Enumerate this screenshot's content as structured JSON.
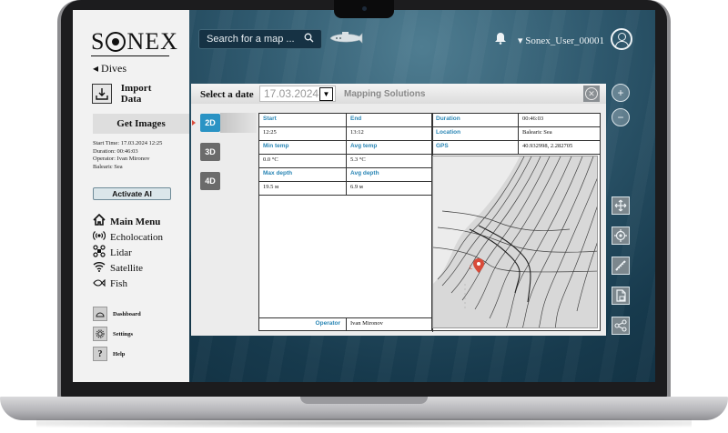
{
  "app": {
    "logo_text": "SONEX",
    "logo_left": "S",
    "logo_right": "NEX"
  },
  "sidebar": {
    "back_label": "◂ Dives",
    "import_label": "Import Data",
    "get_images_label": "Get Images",
    "dive_info": {
      "start_time": "Start Time: 17.03.2024 12:25",
      "duration": "Duration: 00:46:03",
      "operator": "Operator: Ivan Mironov",
      "location": "Balearic Sea"
    },
    "activate_ai_label": "Activate AI",
    "nav_items": [
      {
        "label": "Main Menu",
        "icon": "home-icon",
        "bold": true
      },
      {
        "label": "Echolocation",
        "icon": "echolocation-icon",
        "bold": false
      },
      {
        "label": "Lidar",
        "icon": "drone-icon",
        "bold": false
      },
      {
        "label": "Satellite",
        "icon": "satellite-icon",
        "bold": false
      },
      {
        "label": "Fish",
        "icon": "fish-icon",
        "bold": false
      }
    ],
    "small_items": [
      {
        "label": "Dashboard",
        "icon": "dashboard-icon"
      },
      {
        "label": "Settings",
        "icon": "settings-icon"
      },
      {
        "label": "Help",
        "icon": "help-icon"
      }
    ]
  },
  "header": {
    "search_placeholder": "Search for a map ...",
    "username": "▾ Sonex_User_00001"
  },
  "panel": {
    "select_date_label": "Select a date",
    "date_value": "17.03.2024",
    "title": "Mapping Solutions",
    "modes": [
      "2D",
      "3D",
      "4D"
    ],
    "active_mode": "2D",
    "fields": {
      "start_label": "Start",
      "start_value": "12:25",
      "end_label": "End",
      "end_value": "13:12",
      "min_temp_label": "Min temp",
      "min_temp_value": "0.0 °C",
      "avg_temp_label": "Avg temp",
      "avg_temp_value": "5.3 °C",
      "max_depth_label": "Max depth",
      "max_depth_value": "19.5 м",
      "avg_depth_label": "Avg depth",
      "avg_depth_value": "6.9 м",
      "duration_label": "Duration",
      "duration_value": "00:46:03",
      "location_label": "Location",
      "location_value": "Balearic Sea",
      "gps_label": "GPS",
      "gps_value": "40.932998, 2.282705",
      "operator_label": "Operator",
      "operator_value": "Ivan Mironov"
    }
  },
  "colors": {
    "accent": "#2a93c4",
    "header_label": "#2a86b5",
    "ocean_dark": "#0f2c3c",
    "pin": "#d84b3a"
  }
}
